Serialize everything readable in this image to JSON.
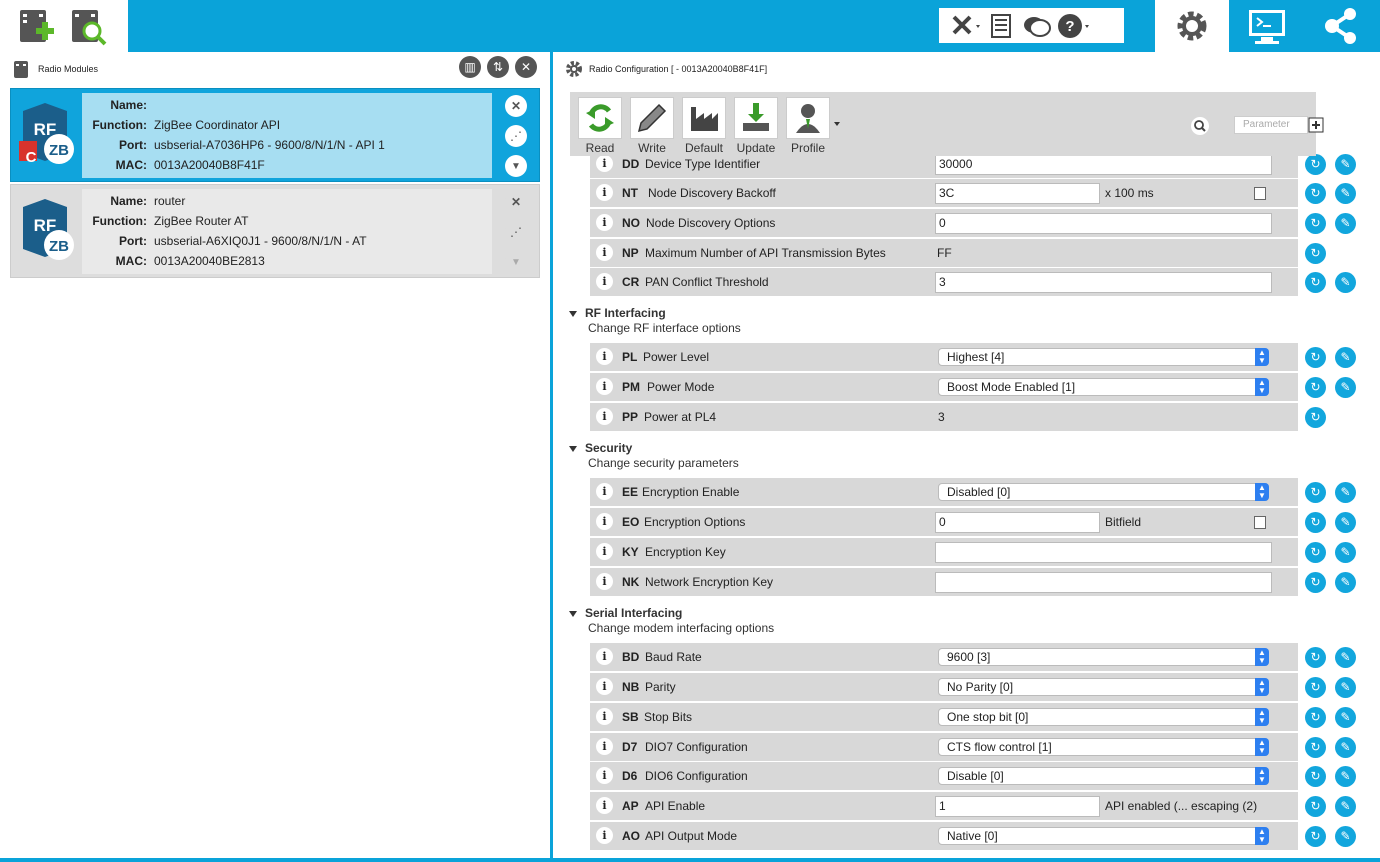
{
  "top_bar": {
    "icons": [
      "add-module-icon",
      "discover-module-icon",
      "tools-icon",
      "console-log-icon",
      "feedback-icon",
      "help-icon",
      "configuration-mode-icon",
      "console-mode-icon",
      "network-mode-icon"
    ],
    "accent": "#0aa3d9"
  },
  "left_panel": {
    "title": "Radio Modules",
    "modules": [
      {
        "name": "",
        "function": "ZigBee Coordinator API",
        "port": "usbserial-A7036HP6 - 9600/8/N/1/N - API 1",
        "mac": "0013A20040B8F41F",
        "badge": "C"
      },
      {
        "name": "router",
        "function": "ZigBee Router AT",
        "port": "usbserial-A6XIQ0J1 - 9600/8/N/1/N - AT",
        "mac": "0013A20040BE2813",
        "badge": ""
      }
    ],
    "labels": {
      "name": "Name:",
      "function": "Function:",
      "port": "Port:",
      "mac": "MAC:"
    }
  },
  "right_panel": {
    "title": "Radio Configuration [  - 0013A20040B8F41F]",
    "toolbar": {
      "read": "Read",
      "write": "Write",
      "default": "Default",
      "update": "Update",
      "profile": "Profile"
    },
    "search_placeholder": "Parameter",
    "top_params": [
      {
        "code": "DD",
        "name": "Device Type Identifier",
        "value": "30000"
      },
      {
        "code": "NT",
        "name": "Node Discovery Backoff",
        "value": "3C",
        "suffix": "x 100 ms"
      },
      {
        "code": "NO",
        "name": "Node Discovery Options",
        "value": "0"
      },
      {
        "code": "NP",
        "name": "Maximum Number of API Transmission Bytes",
        "value": "FF"
      },
      {
        "code": "CR",
        "name": "PAN Conflict Threshold",
        "value": "3"
      }
    ],
    "sections": {
      "rf": {
        "title": "RF Interfacing",
        "subtitle": "Change RF interface options",
        "params": [
          {
            "code": "PL",
            "name": "Power Level",
            "value": "Highest [4]"
          },
          {
            "code": "PM",
            "name": "Power Mode",
            "value": "Boost Mode Enabled [1]"
          },
          {
            "code": "PP",
            "name": "Power at PL4",
            "value": "3"
          }
        ]
      },
      "security": {
        "title": "Security",
        "subtitle": "Change security parameters",
        "params": [
          {
            "code": "EE",
            "name": "Encryption Enable",
            "value": "Disabled [0]"
          },
          {
            "code": "EO",
            "name": "Encryption Options",
            "value": "0",
            "suffix": "Bitfield"
          },
          {
            "code": "KY",
            "name": "Encryption Key",
            "value": ""
          },
          {
            "code": "NK",
            "name": "Network Encryption Key",
            "value": ""
          }
        ]
      },
      "serial": {
        "title": "Serial Interfacing",
        "subtitle": "Change modem interfacing options",
        "params": [
          {
            "code": "BD",
            "name": "Baud Rate",
            "value": "9600 [3]"
          },
          {
            "code": "NB",
            "name": "Parity",
            "value": "No Parity [0]"
          },
          {
            "code": "SB",
            "name": "Stop Bits",
            "value": "One stop bit [0]"
          },
          {
            "code": "D7",
            "name": "DIO7 Configuration",
            "value": "CTS flow control [1]"
          },
          {
            "code": "D6",
            "name": "DIO6 Configuration",
            "value": "Disable [0]"
          },
          {
            "code": "AP",
            "name": "API Enable",
            "value": "1",
            "suffix": "API enabled (... escaping (2)"
          },
          {
            "code": "AO",
            "name": "API Output Mode",
            "value": "Native [0]"
          }
        ]
      }
    }
  }
}
